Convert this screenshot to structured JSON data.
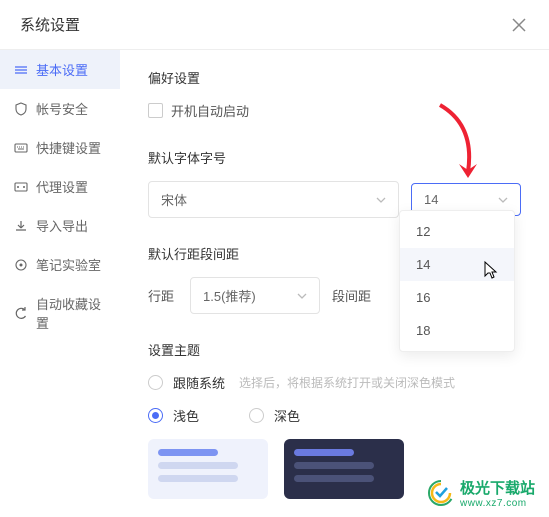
{
  "header": {
    "title": "系统设置"
  },
  "sidebar": {
    "items": [
      {
        "label": "基本设置",
        "icon": "settings"
      },
      {
        "label": "帐号安全",
        "icon": "shield"
      },
      {
        "label": "快捷键设置",
        "icon": "keyboard"
      },
      {
        "label": "代理设置",
        "icon": "proxy"
      },
      {
        "label": "导入导出",
        "icon": "import"
      },
      {
        "label": "笔记实验室",
        "icon": "lab"
      },
      {
        "label": "自动收藏设置",
        "icon": "auto"
      }
    ]
  },
  "prefs": {
    "section_title": "偏好设置",
    "autostart_label": "开机自动启动"
  },
  "font": {
    "section_title": "默认字体字号",
    "family": "宋体",
    "size": "14",
    "options": [
      "12",
      "14",
      "16",
      "18"
    ]
  },
  "spacing": {
    "section_title": "默认行距段间距",
    "line_label": "行距",
    "line_value": "1.5(推荐)",
    "para_label": "段间距"
  },
  "theme": {
    "section_title": "设置主题",
    "follow_label": "跟随系统",
    "follow_hint": "选择后，将根据系统打开或关闭深色模式",
    "light_label": "浅色",
    "dark_label": "深色"
  },
  "watermark": {
    "name": "极光下载站",
    "url": "www.xz7.com"
  }
}
